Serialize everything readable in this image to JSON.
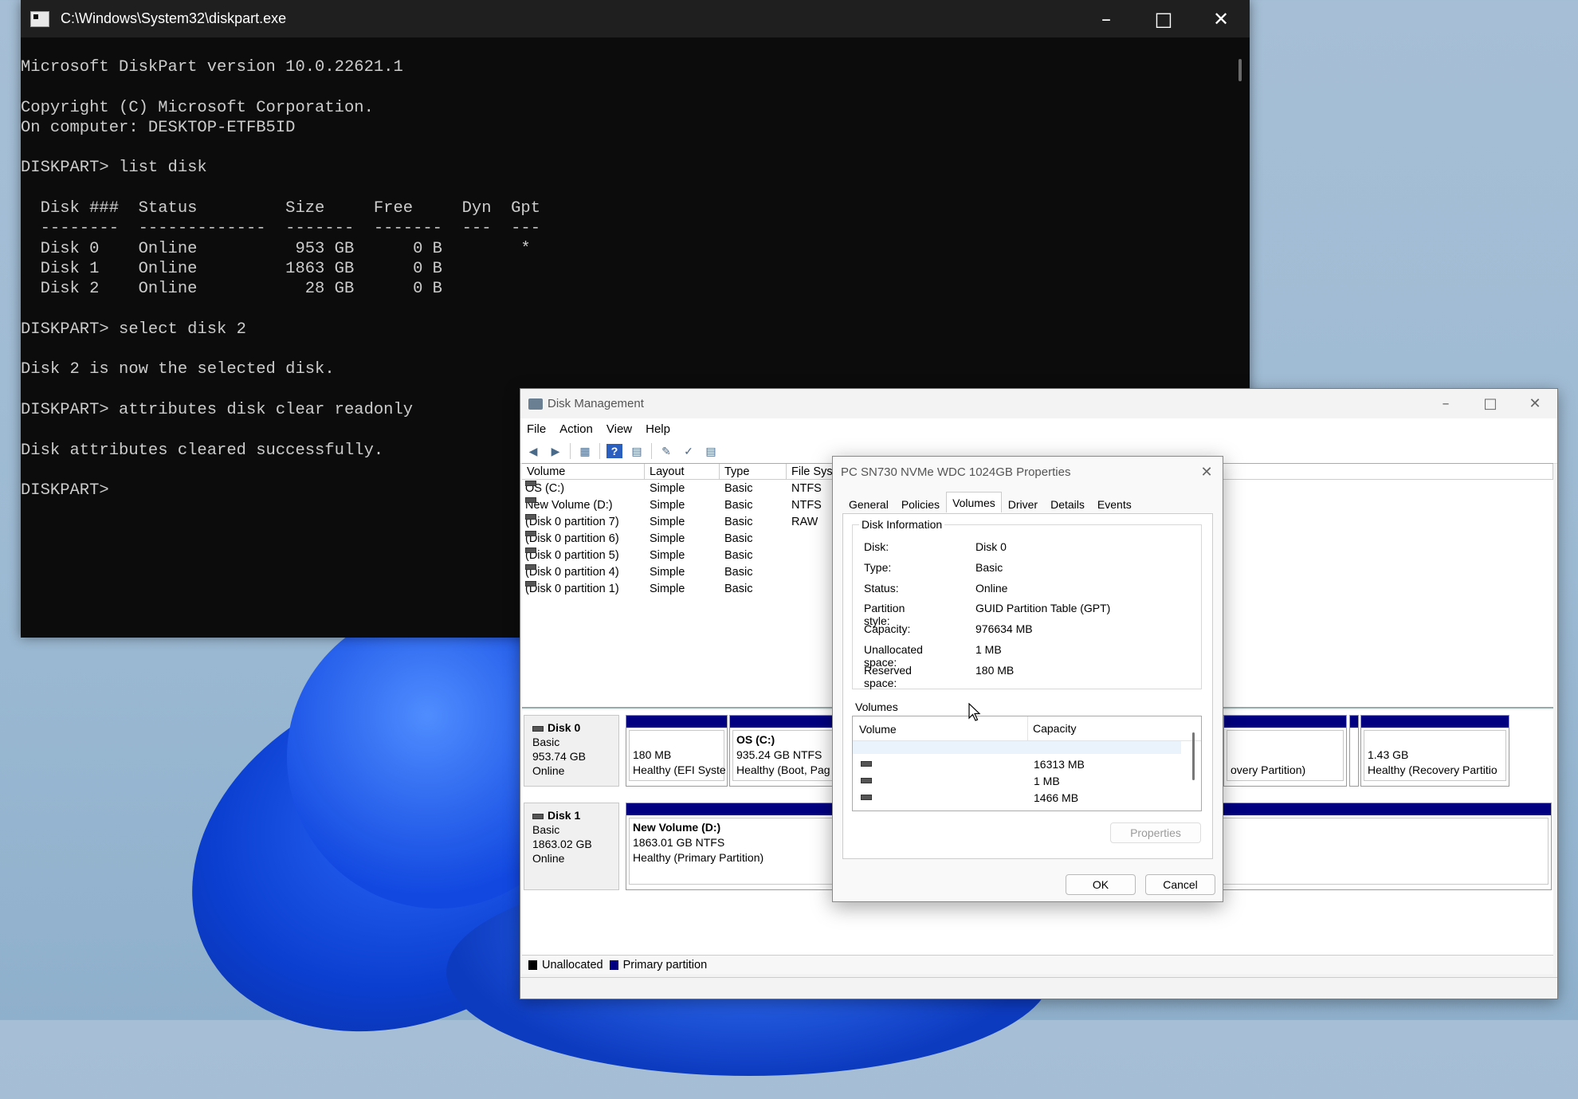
{
  "cmd": {
    "title": "C:\\Windows\\System32\\diskpart.exe",
    "lines": [
      "Microsoft DiskPart version 10.0.22621.1",
      "",
      "Copyright (C) Microsoft Corporation.",
      "On computer: DESKTOP-ETFB5ID",
      "",
      "DISKPART> list disk",
      "",
      "  Disk ###  Status         Size     Free     Dyn  Gpt",
      "  --------  -------------  -------  -------  ---  ---",
      "  Disk 0    Online          953 GB      0 B        *",
      "  Disk 1    Online         1863 GB      0 B",
      "  Disk 2    Online           28 GB      0 B",
      "",
      "DISKPART> select disk 2",
      "",
      "Disk 2 is now the selected disk.",
      "",
      "DISKPART> attributes disk clear readonly",
      "",
      "Disk attributes cleared successfully.",
      "",
      "DISKPART> "
    ]
  },
  "dm": {
    "title": "Disk Management",
    "menu": [
      "File",
      "Action",
      "View",
      "Help"
    ],
    "columns": [
      "Volume",
      "Layout",
      "Type",
      "File Sys"
    ],
    "volumes": [
      {
        "name": "OS (C:)",
        "layout": "Simple",
        "type": "Basic",
        "fs": "NTFS"
      },
      {
        "name": "New Volume (D:)",
        "layout": "Simple",
        "type": "Basic",
        "fs": "NTFS"
      },
      {
        "name": "(Disk 0 partition 7)",
        "layout": "Simple",
        "type": "Basic",
        "fs": "RAW"
      },
      {
        "name": "(Disk 0 partition 6)",
        "layout": "Simple",
        "type": "Basic",
        "fs": ""
      },
      {
        "name": "(Disk 0 partition 5)",
        "layout": "Simple",
        "type": "Basic",
        "fs": ""
      },
      {
        "name": "(Disk 0 partition 4)",
        "layout": "Simple",
        "type": "Basic",
        "fs": ""
      },
      {
        "name": "(Disk 0 partition 1)",
        "layout": "Simple",
        "type": "Basic",
        "fs": ""
      }
    ],
    "disks": [
      {
        "name": "Disk 0",
        "type": "Basic",
        "size": "953.74 GB",
        "status": "Online",
        "partitions": [
          {
            "title": "",
            "size": "180 MB",
            "status": "Healthy (EFI Syste"
          },
          {
            "title": "OS  (C:)",
            "size": "935.24 GB NTFS",
            "status": "Healthy (Boot, Pag"
          },
          {
            "title": "",
            "size": "",
            "status": "overy Partition)"
          },
          {
            "title": "",
            "size": "1.43 GB",
            "status": "Healthy (Recovery Partitio"
          }
        ]
      },
      {
        "name": "Disk 1",
        "type": "Basic",
        "size": "1863.02 GB",
        "status": "Online",
        "partitions": [
          {
            "title": "New Volume  (D:)",
            "size": "1863.01 GB NTFS",
            "status": "Healthy (Primary Partition)"
          }
        ]
      }
    ],
    "legend": {
      "unallocated": "Unallocated",
      "primary": "Primary partition",
      "unallocated_color": "#000000",
      "primary_color": "#000080"
    }
  },
  "props": {
    "title": "PC SN730 NVMe WDC 1024GB Properties",
    "tabs": [
      "General",
      "Policies",
      "Volumes",
      "Driver",
      "Details",
      "Events"
    ],
    "active_tab": "Volumes",
    "group_label": "Disk Information",
    "info": [
      {
        "k": "Disk:",
        "v": "Disk 0"
      },
      {
        "k": "Type:",
        "v": "Basic"
      },
      {
        "k": "Status:",
        "v": "Online"
      },
      {
        "k": "Partition style:",
        "v": "GUID Partition Table (GPT)"
      },
      {
        "k": "Capacity:",
        "v": "976634 MB"
      },
      {
        "k": "Unallocated space:",
        "v": "1 MB"
      },
      {
        "k": "Reserved space:",
        "v": "180 MB"
      }
    ],
    "volumes_label": "Volumes",
    "list_headers": [
      "Volume",
      "Capacity"
    ],
    "list_rows": [
      {
        "volume": "",
        "capacity": "16313 MB"
      },
      {
        "volume": "",
        "capacity": "1 MB"
      },
      {
        "volume": "",
        "capacity": "1466 MB"
      }
    ],
    "properties_button": "Properties",
    "ok": "OK",
    "cancel": "Cancel"
  }
}
